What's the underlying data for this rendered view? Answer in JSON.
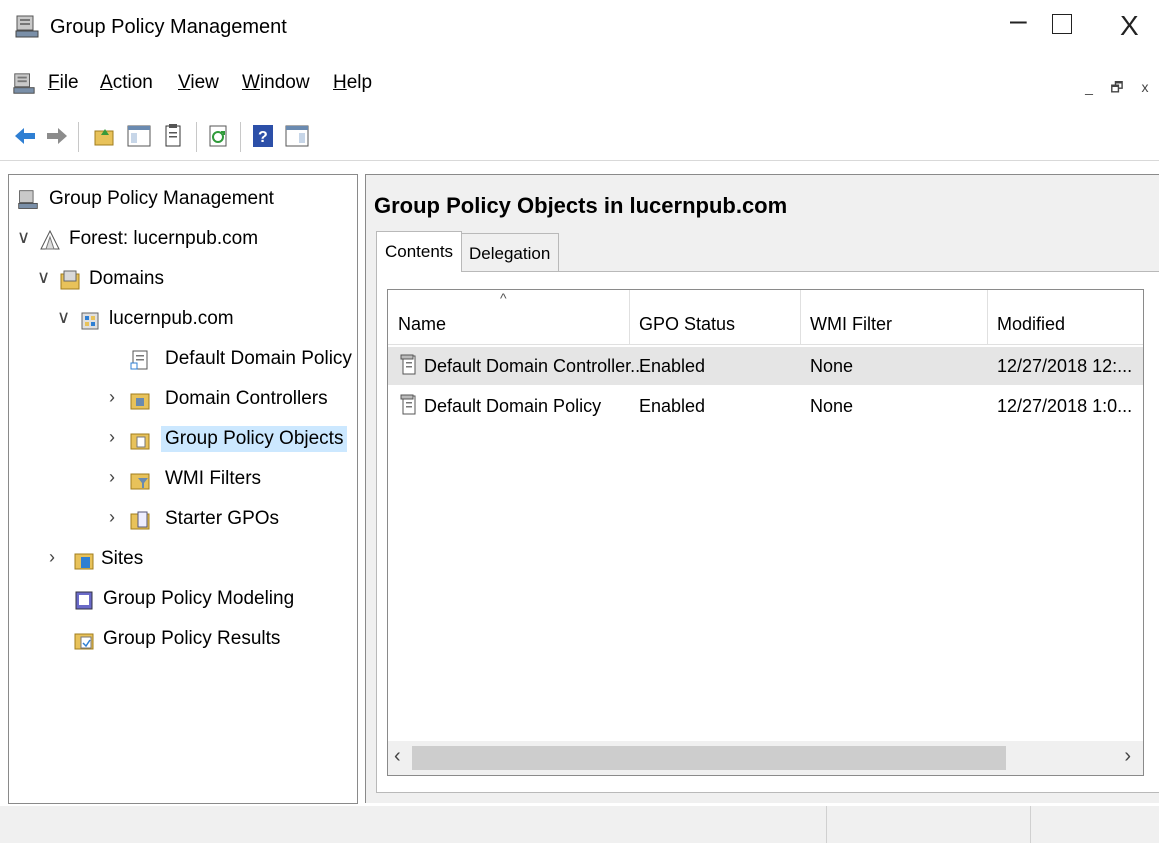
{
  "window": {
    "title": "Group Policy Management",
    "controls": {
      "minimize": "–",
      "close": "X"
    }
  },
  "menu": {
    "items": [
      {
        "label": "File",
        "accel": "F"
      },
      {
        "label": "Action",
        "accel": "A"
      },
      {
        "label": "View",
        "accel": "V"
      },
      {
        "label": "Window",
        "accel": "W"
      },
      {
        "label": "Help",
        "accel": "H"
      }
    ],
    "mdi_controls": {
      "minimize": "_",
      "restore": "🗗",
      "close": "x"
    }
  },
  "toolbar": {
    "buttons": [
      "back-icon",
      "forward-icon",
      "up-folder-icon",
      "show-hide-tree-icon",
      "properties-icon",
      "refresh-icon",
      "help-icon",
      "show-action-pane-icon"
    ]
  },
  "tree": {
    "root": "Group Policy Management",
    "forest": "Forest: lucernpub.com",
    "domains": "Domains",
    "domain": "lucernpub.com",
    "default_domain_policy": "Default Domain Policy",
    "domain_controllers": "Domain Controllers",
    "group_policy_objects": "Group Policy Objects",
    "wmi_filters": "WMI Filters",
    "starter_gpos": "Starter GPOs",
    "sites": "Sites",
    "modeling": "Group Policy Modeling",
    "results": "Group Policy Results"
  },
  "main": {
    "title": "Group Policy Objects in lucernpub.com",
    "tabs": [
      {
        "label": "Contents",
        "active": true
      },
      {
        "label": "Delegation",
        "active": false
      }
    ],
    "columns": [
      "Name",
      "GPO Status",
      "WMI Filter",
      "Modified"
    ],
    "sort_indicator": "^",
    "rows": [
      {
        "name": "Default Domain Controller...",
        "status": "Enabled",
        "wmi": "None",
        "modified": "12/27/2018 12:..."
      },
      {
        "name": "Default Domain Policy",
        "status": "Enabled",
        "wmi": "None",
        "modified": "12/27/2018 1:0..."
      }
    ],
    "scroll": {
      "left": "‹",
      "right": "›"
    }
  },
  "colors": {
    "selection": "#cce8ff",
    "row_highlight": "#e5e5e5",
    "panel_bg": "#f0f0f0"
  }
}
